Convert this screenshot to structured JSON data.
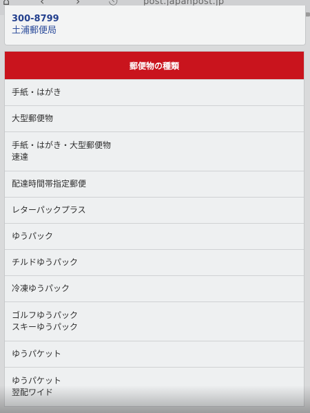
{
  "browser": {
    "url_fragment": "post.japanpost.jp",
    "icons": [
      "home-icon",
      "back-icon",
      "forward-icon",
      "menu-dots-icon"
    ]
  },
  "office": {
    "postal_code": "300-8799",
    "name": "土浦郵便局"
  },
  "mail_types": {
    "header": "郵便物の種類",
    "items": [
      {
        "lines": [
          "手紙・はがき"
        ]
      },
      {
        "lines": [
          "大型郵便物"
        ]
      },
      {
        "lines": [
          "手紙・はがき・大型郵便物",
          "速達"
        ]
      },
      {
        "lines": [
          "配達時間帯指定郵便"
        ]
      },
      {
        "lines": [
          "レターパックプラス"
        ]
      },
      {
        "lines": [
          "ゆうパック"
        ]
      },
      {
        "lines": [
          "チルドゆうパック"
        ]
      },
      {
        "lines": [
          "冷凍ゆうパック"
        ]
      },
      {
        "lines": [
          "ゴルフゆうパック",
          "スキーゆうパック"
        ]
      },
      {
        "lines": [
          "ゆうパケット"
        ]
      },
      {
        "lines": [
          "ゆうパケット",
          "翌配ワイド"
        ]
      }
    ]
  },
  "colors": {
    "header_red": "#c9141d",
    "office_link_blue": "#23408e"
  }
}
